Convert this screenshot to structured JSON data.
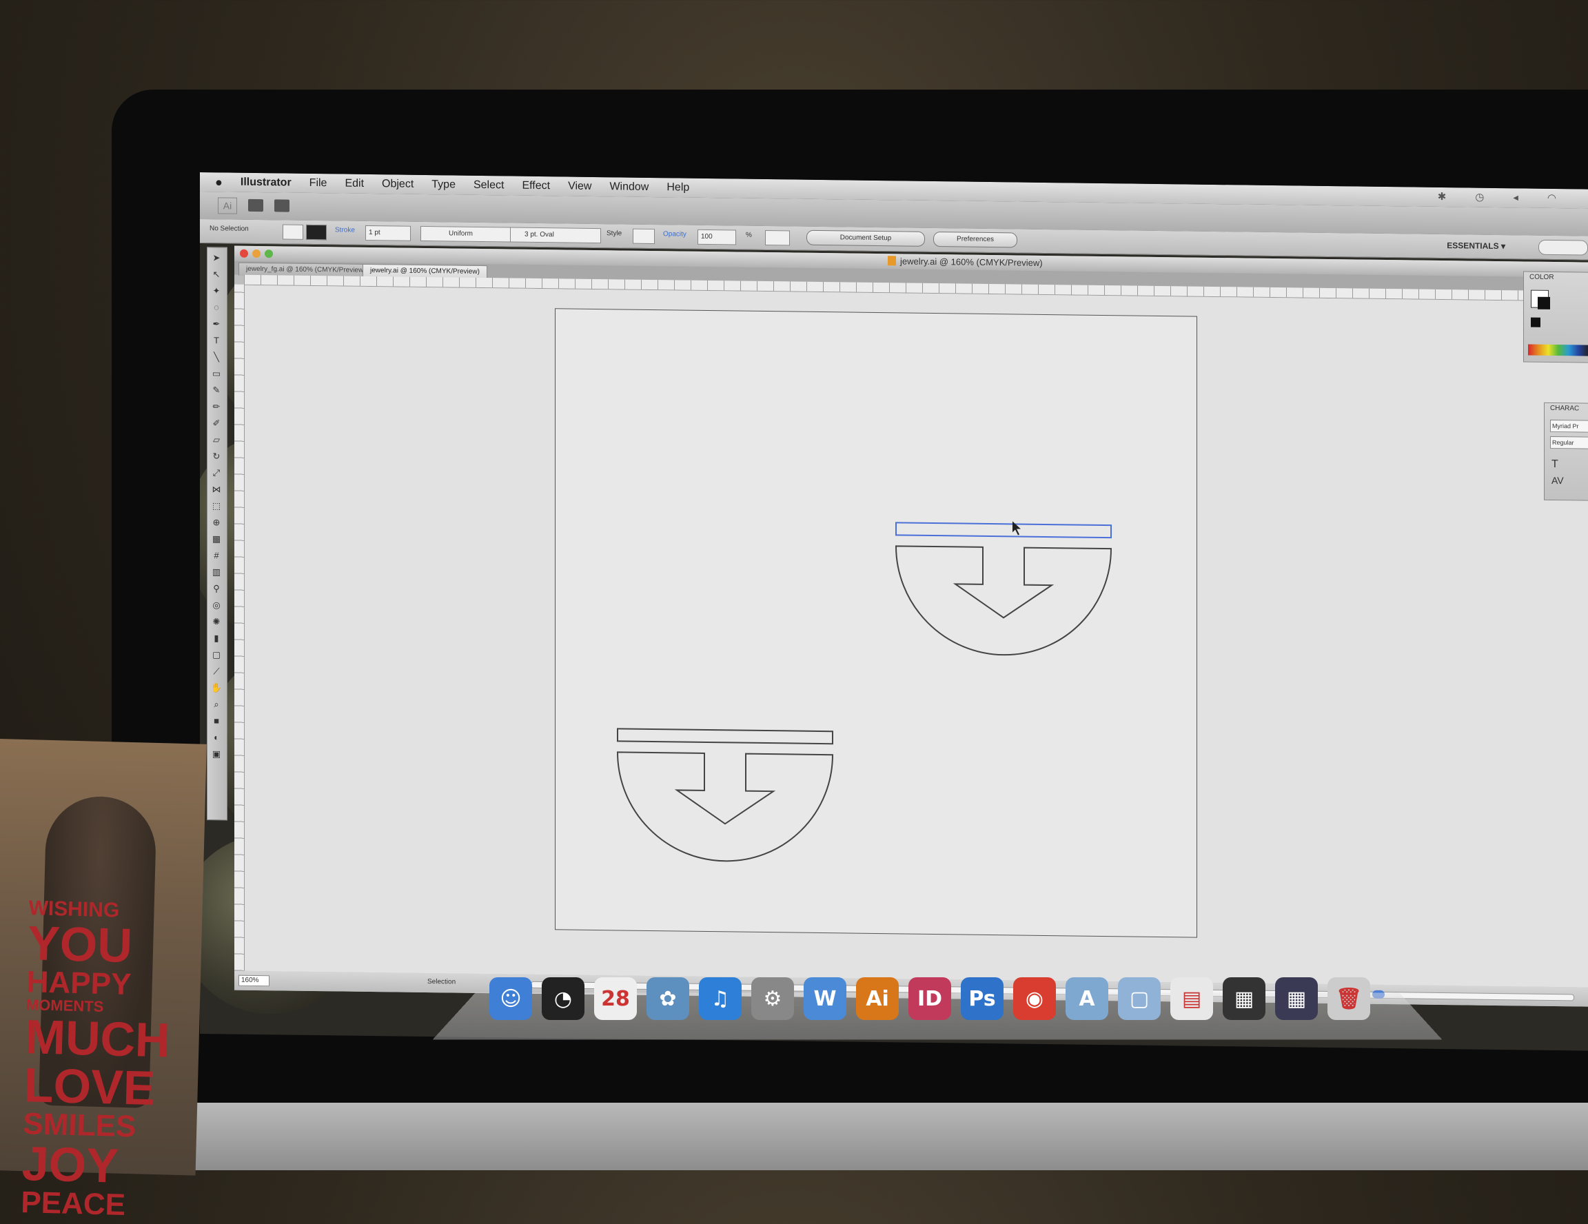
{
  "menubar": {
    "app_name": "Illustrator",
    "items": [
      "File",
      "Edit",
      "Object",
      "Type",
      "Select",
      "Effect",
      "View",
      "Window",
      "Help"
    ]
  },
  "controlbar": {
    "selection_label": "No Selection",
    "stroke_label": "Stroke",
    "stroke_value": "1 pt",
    "profile_value": "Uniform",
    "brush_value": "3 pt. Oval",
    "style_label": "Style",
    "opacity_label": "Opacity",
    "opacity_value": "100",
    "opacity_unit": "%",
    "document_setup_button": "Document Setup",
    "preferences_button": "Preferences",
    "workspace_label": "ESSENTIALS ▾"
  },
  "document": {
    "window_title": "jewelry.ai @ 160% (CMYK/Preview)",
    "tabs": [
      {
        "label": "jewelry_fg.ai @ 160% (CMYK/Preview)",
        "active": false
      },
      {
        "label": "jewelry.ai @ 160% (CMYK/Preview)",
        "active": true
      }
    ],
    "zoom_value": "160%",
    "status_label": "Selection"
  },
  "panels": {
    "color_tab": "COLOR",
    "character_tab": "CHARAC",
    "font_family": "Myriad Pr",
    "font_style": "Regular"
  },
  "dock": {
    "items": [
      {
        "name": "finder-icon",
        "glyph": "☺",
        "color": "#3f7fd6"
      },
      {
        "name": "dashboard-icon",
        "glyph": "◔",
        "color": "#222222"
      },
      {
        "name": "calendar-icon",
        "glyph": "28",
        "color": "#eeeeee"
      },
      {
        "name": "iphoto-icon",
        "glyph": "✿",
        "color": "#5d8fbf"
      },
      {
        "name": "itunes-icon",
        "glyph": "♫",
        "color": "#2e7fd7"
      },
      {
        "name": "system-preferences-icon",
        "glyph": "⚙",
        "color": "#888888"
      },
      {
        "name": "word-icon",
        "glyph": "W",
        "color": "#4a8ad6"
      },
      {
        "name": "illustrator-icon",
        "glyph": "Ai",
        "color": "#d8761a"
      },
      {
        "name": "indesign-icon",
        "glyph": "ID",
        "color": "#c23a5b"
      },
      {
        "name": "photoshop-icon",
        "glyph": "Ps",
        "color": "#2e72c9"
      },
      {
        "name": "chrome-icon",
        "glyph": "◉",
        "color": "#d93d2f"
      },
      {
        "name": "applications-folder-icon",
        "glyph": "A",
        "color": "#7fa8d1"
      },
      {
        "name": "documents-folder-icon",
        "glyph": "▢",
        "color": "#8fb2d6"
      },
      {
        "name": "document-stack-icon",
        "glyph": "▤",
        "color": "#e8e8e8"
      },
      {
        "name": "photoshop-window-icon",
        "glyph": "▦",
        "color": "#333333"
      },
      {
        "name": "chrome-window-icon",
        "glyph": "▦",
        "color": "#3a3a55"
      },
      {
        "name": "trash-icon",
        "glyph": "🗑",
        "color": "#cccccc"
      }
    ]
  },
  "photo_words": [
    "WISHING",
    "YOU",
    "HAPPY",
    "MOMENTS",
    "MUCH",
    "LOVE",
    "SMILES",
    "JOY",
    "PEACE"
  ]
}
